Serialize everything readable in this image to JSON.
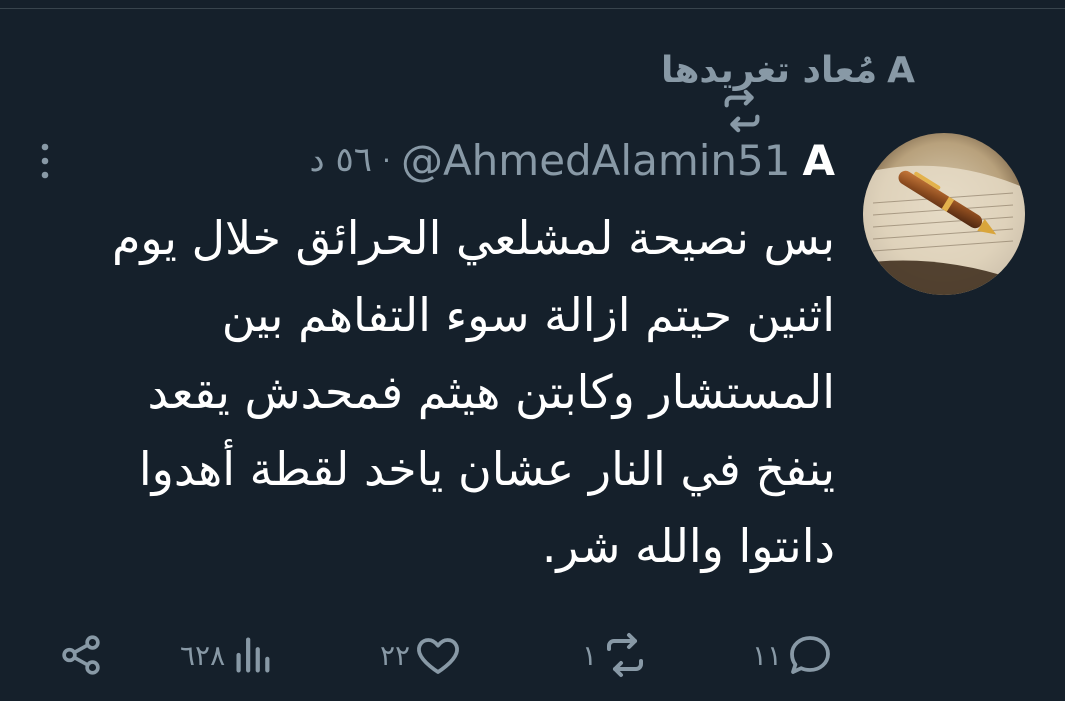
{
  "retweet_context": {
    "name": "A",
    "label": "مُعاد تغريدها",
    "icon": "retweet-icon"
  },
  "tweet": {
    "display_name": "A",
    "handle": "@AhmedAlamin51",
    "separator": "·",
    "time": "٥٦ د",
    "text": "بس نصيحة لمشلعي الحرائق خلال يوم\nاثنين حيتم ازالة سوء التفاهم بين\nالمستشار وكابتن هيثم فمحدش يقعد\nينفخ في النار عشان ياخد لقطة أهدوا\nدانتوا والله شر.",
    "avatar_icon": "pen-on-book-avatar",
    "more_icon": "more-vertical-icon"
  },
  "actions": {
    "reply": {
      "icon": "reply-icon",
      "count": "١١"
    },
    "retweet": {
      "icon": "retweet-icon",
      "count": "١"
    },
    "like": {
      "icon": "heart-icon",
      "count": "٢٢"
    },
    "views": {
      "icon": "analytics-icon",
      "count": "٦٢٨"
    },
    "share": {
      "icon": "share-icon"
    }
  },
  "colors": {
    "background": "#15202b",
    "text": "#ffffff",
    "muted": "#8899a6",
    "divider": "#38444d"
  }
}
